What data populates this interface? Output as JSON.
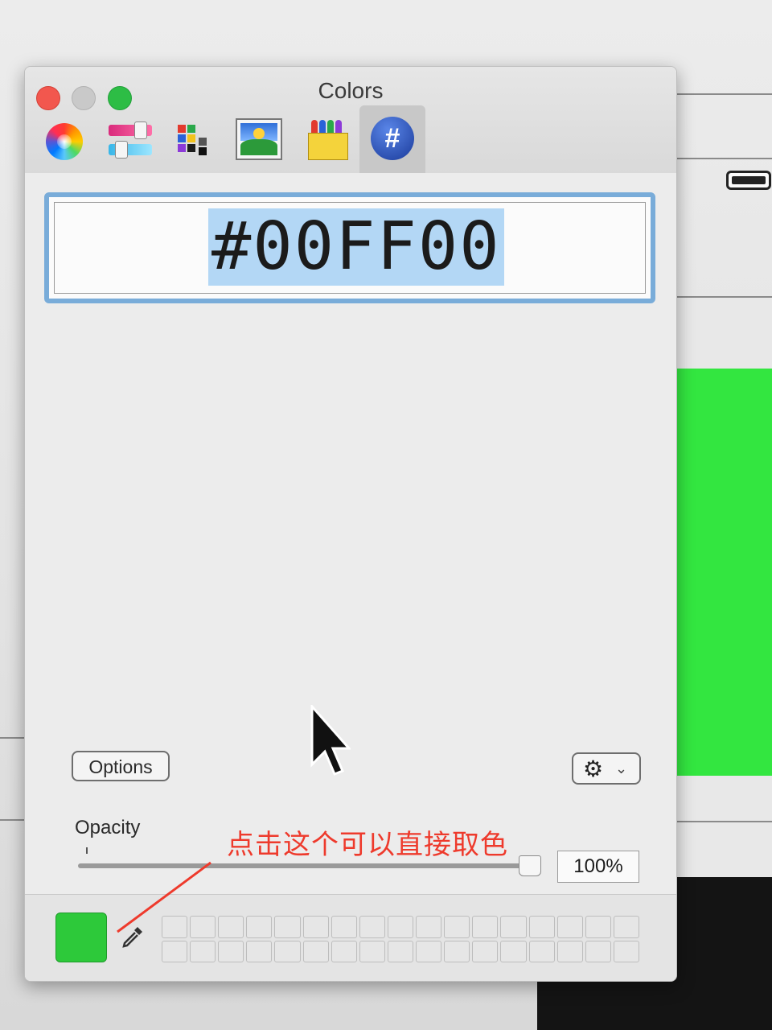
{
  "window": {
    "title": "Colors"
  },
  "toolbar": {
    "tabs": [
      {
        "name": "color-wheel",
        "icon": "color-wheel-icon"
      },
      {
        "name": "color-sliders",
        "icon": "sliders-icon"
      },
      {
        "name": "color-palettes",
        "icon": "palettes-icon"
      },
      {
        "name": "image-palettes",
        "icon": "image-icon"
      },
      {
        "name": "pencils",
        "icon": "crayons-icon"
      },
      {
        "name": "hex",
        "icon": "hash-icon",
        "label": "#",
        "selected": true
      }
    ]
  },
  "hex": {
    "value": "#00FF00"
  },
  "options": {
    "label": "Options"
  },
  "opacity": {
    "label": "Opacity",
    "value": "100%",
    "fraction": 1.0
  },
  "current_color": {
    "hex": "#2dc93a"
  },
  "annotation": {
    "text": "点击这个可以直接取色",
    "color": "#ee3a2c"
  },
  "swatches": {
    "rows": 2,
    "cols": 17
  }
}
